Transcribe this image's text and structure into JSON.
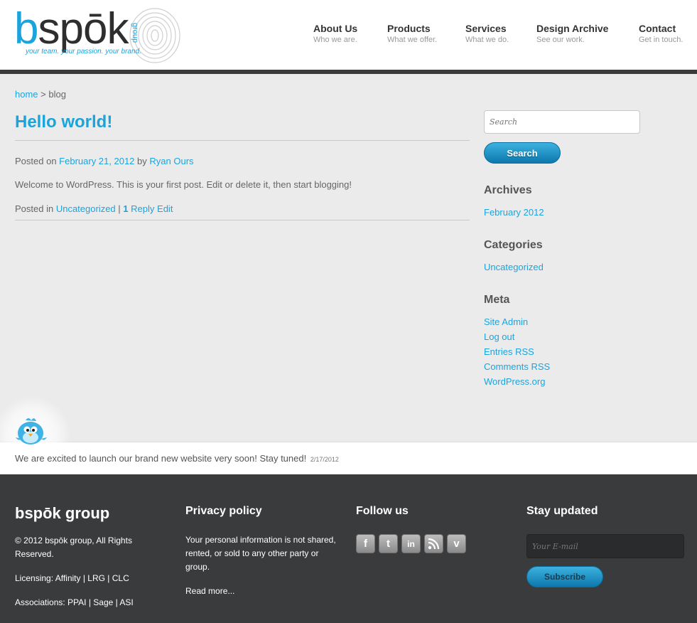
{
  "brand": {
    "logo_b": "b",
    "logo_rest": "spōk",
    "logo_group": "group",
    "tagline": "your team. your passion. your brand."
  },
  "nav": [
    {
      "title": "About Us",
      "subtitle": "Who we are."
    },
    {
      "title": "Products",
      "subtitle": "What we offer."
    },
    {
      "title": "Services",
      "subtitle": "What we do."
    },
    {
      "title": "Design Archive",
      "subtitle": "See our work."
    },
    {
      "title": "Contact",
      "subtitle": "Get in touch."
    }
  ],
  "breadcrumb": {
    "home": "home",
    "separator": ">",
    "current": "blog"
  },
  "post": {
    "title": "Hello world!",
    "posted_on_label": "Posted on",
    "date": "February 21, 2012",
    "by_label": "by",
    "author": "Ryan Ours",
    "body": "Welcome to WordPress. This is your first post. Edit or delete it, then start blogging!",
    "posted_in_label": "Posted in",
    "category": "Uncategorized",
    "separator": "|",
    "reply_count": "1",
    "reply_label": "Reply",
    "edit_label": "Edit"
  },
  "sidebar": {
    "search_placeholder": "Search",
    "search_button": "Search",
    "archives_title": "Archives",
    "archives": [
      "February 2012"
    ],
    "categories_title": "Categories",
    "categories": [
      "Uncategorized"
    ],
    "meta_title": "Meta",
    "meta_links": [
      "Site Admin",
      "Log out",
      "Entries RSS",
      "Comments RSS",
      "WordPress.org"
    ]
  },
  "tweet": {
    "text": "We are excited to launch our brand new website very soon! Stay tuned!",
    "date": "2/17/2012"
  },
  "footer": {
    "brand_title": "bspōk group",
    "copyright": "© 2012 bspōk group, All Rights Reserved.",
    "licensing": "Licensing: Affinity | LRG | CLC",
    "associations": "Associations: PPAI | Sage | ASI",
    "privacy_title": "Privacy policy",
    "privacy_text": "Your personal information is not shared, rented, or sold to any other party or group.",
    "read_more": "Read more...",
    "follow_title": "Follow us",
    "social": [
      "facebook-icon",
      "twitter-icon",
      "linkedin-icon",
      "rss-icon",
      "vimeo-icon"
    ],
    "stay_title": "Stay updated",
    "email_placeholder": "Your E-mail",
    "subscribe_button": "Subscribe"
  },
  "colors": {
    "accent": "#1ba4dc",
    "footer_bg": "#3a3b3d",
    "page_bg": "#ebebeb"
  }
}
